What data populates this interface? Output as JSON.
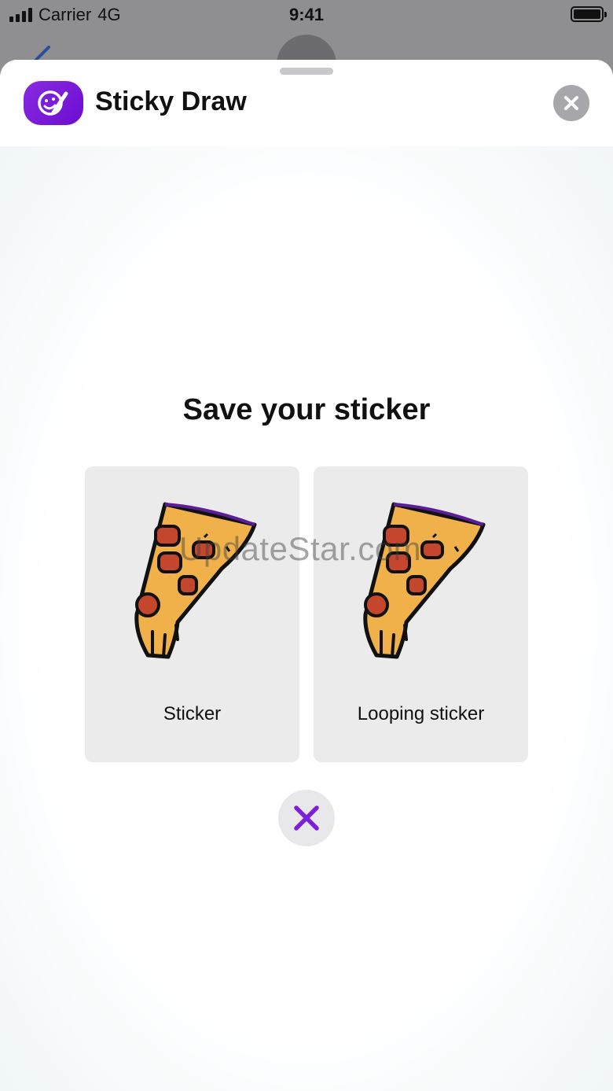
{
  "status_bar": {
    "carrier": "Carrier",
    "network": "4G",
    "time": "9:41"
  },
  "header": {
    "app_name": "Sticky Draw"
  },
  "main": {
    "heading": "Save your sticker",
    "options": [
      {
        "label": "Sticker"
      },
      {
        "label": "Looping sticker"
      }
    ]
  },
  "watermark": "UpdateStar.com",
  "colors": {
    "accent": "#7b1fdc",
    "card_bg": "#ebebeb",
    "close_bg": "#a7a7ab"
  },
  "icons": {
    "app": "draw-smiley-icon",
    "close": "close-icon",
    "cancel": "cancel-x-icon",
    "sticker": "pizza-slice-icon"
  }
}
